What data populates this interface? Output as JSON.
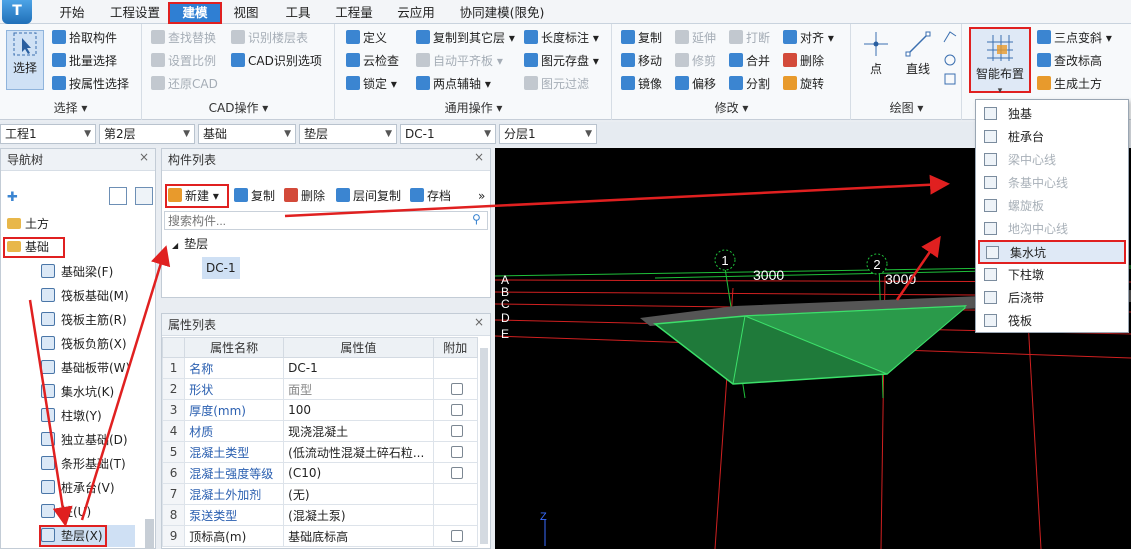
{
  "menubar": {
    "logo": "T",
    "tabs": [
      "开始",
      "工程设置",
      "建模",
      "视图",
      "工具",
      "工程量",
      "云应用",
      "协同建模(限免)"
    ]
  },
  "ribbon": {
    "select_group": {
      "big": "选择",
      "items": [
        "拾取构件",
        "批量选择",
        "按属性选择"
      ],
      "label": "选择 ▾"
    },
    "cad_group": {
      "items": [
        "查找替换",
        "识别楼层表",
        "设置比例",
        "CAD识别选项",
        "还原CAD"
      ],
      "label": "CAD操作 ▾"
    },
    "general_group": {
      "items": [
        "定义",
        "复制到其它层 ▾",
        "长度标注 ▾",
        "云检查",
        "自动平齐板 ▾",
        "图元存盘 ▾",
        "锁定 ▾",
        "两点辅轴 ▾",
        "图元过滤"
      ],
      "label": "通用操作 ▾"
    },
    "modify_group": {
      "items": [
        "复制",
        "延伸",
        "打断",
        "对齐 ▾",
        "移动",
        "修剪",
        "合并",
        "删除",
        "镜像",
        "偏移",
        "分割",
        "旋转"
      ],
      "label": "修改 ▾"
    },
    "draw_group": {
      "items": [
        "点",
        "直线"
      ],
      "label": "绘图 ▾"
    },
    "smart_group": {
      "big": "智能布置",
      "caret": "▾",
      "items": [
        "三点变斜 ▾",
        "查改标高",
        "生成土方"
      ]
    }
  },
  "combos": [
    "工程1",
    "第2层",
    "基础",
    "垫层",
    "DC-1",
    "分层1"
  ],
  "nav": {
    "title": "导航树",
    "close": "×",
    "items": [
      {
        "label": "土方",
        "type": "folder"
      },
      {
        "label": "基础",
        "type": "folder"
      },
      {
        "label": "基础梁(F)"
      },
      {
        "label": "筏板基础(M)"
      },
      {
        "label": "筏板主筋(R)"
      },
      {
        "label": "筏板负筋(X)"
      },
      {
        "label": "基础板带(W)"
      },
      {
        "label": "集水坑(K)"
      },
      {
        "label": "柱墩(Y)"
      },
      {
        "label": "独立基础(D)"
      },
      {
        "label": "条形基础(T)"
      },
      {
        "label": "桩承台(V)"
      },
      {
        "label": "桩(U)"
      },
      {
        "label": "垫层(X)"
      }
    ]
  },
  "components": {
    "title": "构件列表",
    "close": "×",
    "toolbar": [
      "新建 ▾",
      "复制",
      "删除",
      "层间复制",
      "存档"
    ],
    "more": "»",
    "search_placeholder": "搜索构件...",
    "tree_parent": "垫层",
    "tree_child": "DC-1"
  },
  "props": {
    "title": "属性列表",
    "close": "×",
    "headers": [
      "",
      "属性名称",
      "属性值",
      "附加"
    ],
    "rows": [
      {
        "idx": "1",
        "name": "名称",
        "value": "DC-1",
        "check": false,
        "blue": true
      },
      {
        "idx": "2",
        "name": "形状",
        "value": "面型",
        "check": true,
        "blue": true
      },
      {
        "idx": "3",
        "name": "厚度(mm)",
        "value": "100",
        "check": true,
        "blue": true
      },
      {
        "idx": "4",
        "name": "材质",
        "value": "现浇混凝土",
        "check": true,
        "blue": true
      },
      {
        "idx": "5",
        "name": "混凝土类型",
        "value": "(低流动性混凝土碎石粒...",
        "check": true,
        "blue": true
      },
      {
        "idx": "6",
        "name": "混凝土强度等级",
        "value": "(C10)",
        "check": true,
        "blue": true
      },
      {
        "idx": "7",
        "name": "混凝土外加剂",
        "value": "(无)",
        "check": false,
        "blue": true
      },
      {
        "idx": "8",
        "name": "泵送类型",
        "value": "(混凝土泵)",
        "check": false,
        "blue": true
      },
      {
        "idx": "9",
        "name": "顶标高(m)",
        "value": "基础底标高",
        "check": true,
        "blue": false
      }
    ]
  },
  "viewport": {
    "axis_labels": [
      "1",
      "2"
    ],
    "dims": [
      "3000",
      "3000"
    ],
    "row_labels": [
      "A",
      "B",
      "C",
      "D",
      "E"
    ],
    "z_axis": "Z",
    "colors": {
      "grid_red": "#d02020",
      "grid_green": "#1fbf3a",
      "pit_fill": "#1f7a3a",
      "pit_edge": "#3ce06a"
    }
  },
  "dropdown": {
    "items": [
      {
        "label": "独基",
        "enabled": true
      },
      {
        "label": "桩承台",
        "enabled": true
      },
      {
        "label": "梁中心线",
        "enabled": false
      },
      {
        "label": "条基中心线",
        "enabled": false
      },
      {
        "label": "螺旋板",
        "enabled": false
      },
      {
        "label": "地沟中心线",
        "enabled": false
      },
      {
        "label": "集水坑",
        "enabled": true,
        "active": true
      },
      {
        "label": "下柱墩",
        "enabled": true
      },
      {
        "label": "后浇带",
        "enabled": true
      },
      {
        "label": "筏板",
        "enabled": true
      }
    ]
  },
  "colors": {
    "accent": "#2f7fd3",
    "highlight": "#e02020",
    "viewport_bg": "#000000"
  }
}
